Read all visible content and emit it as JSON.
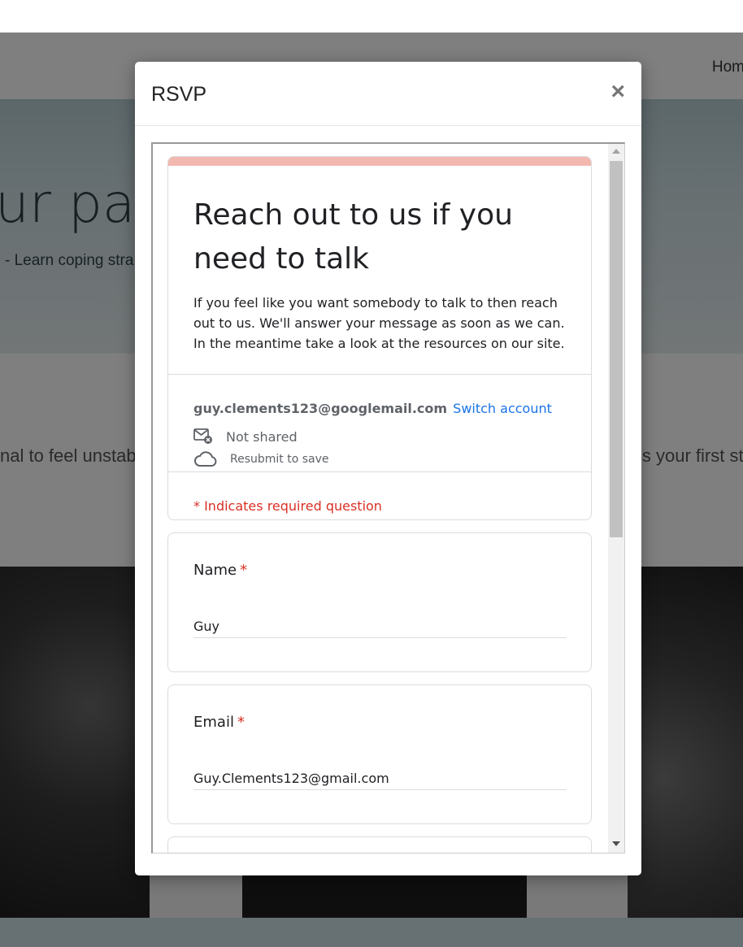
{
  "background": {
    "nav_home": "Hom",
    "hero_title": "ur pat",
    "hero_subtitle": "- Learn coping stra",
    "section_text_left": "nal to feel unstab",
    "section_text_right": "is your first st"
  },
  "modal": {
    "title": "RSVP",
    "close_label": "×"
  },
  "form": {
    "accent_color": "#f2b8af",
    "title": "Reach out to us if you need to talk",
    "description": "If you feel like you want somebody to talk to then reach out to us. We'll answer your message as soon as we can. In the meantime take a look at the resources on our site.",
    "account_email": "guy.clements123@googlemail.com",
    "switch_account": "Switch account",
    "shared_status": "Not shared",
    "save_status": "Resubmit to save",
    "required_note": "* Indicates required question",
    "questions": [
      {
        "label": "Name",
        "required_mark": "*",
        "value": "Guy"
      },
      {
        "label": "Email",
        "required_mark": "*",
        "value": "Guy.Clements123@gmail.com"
      }
    ]
  }
}
